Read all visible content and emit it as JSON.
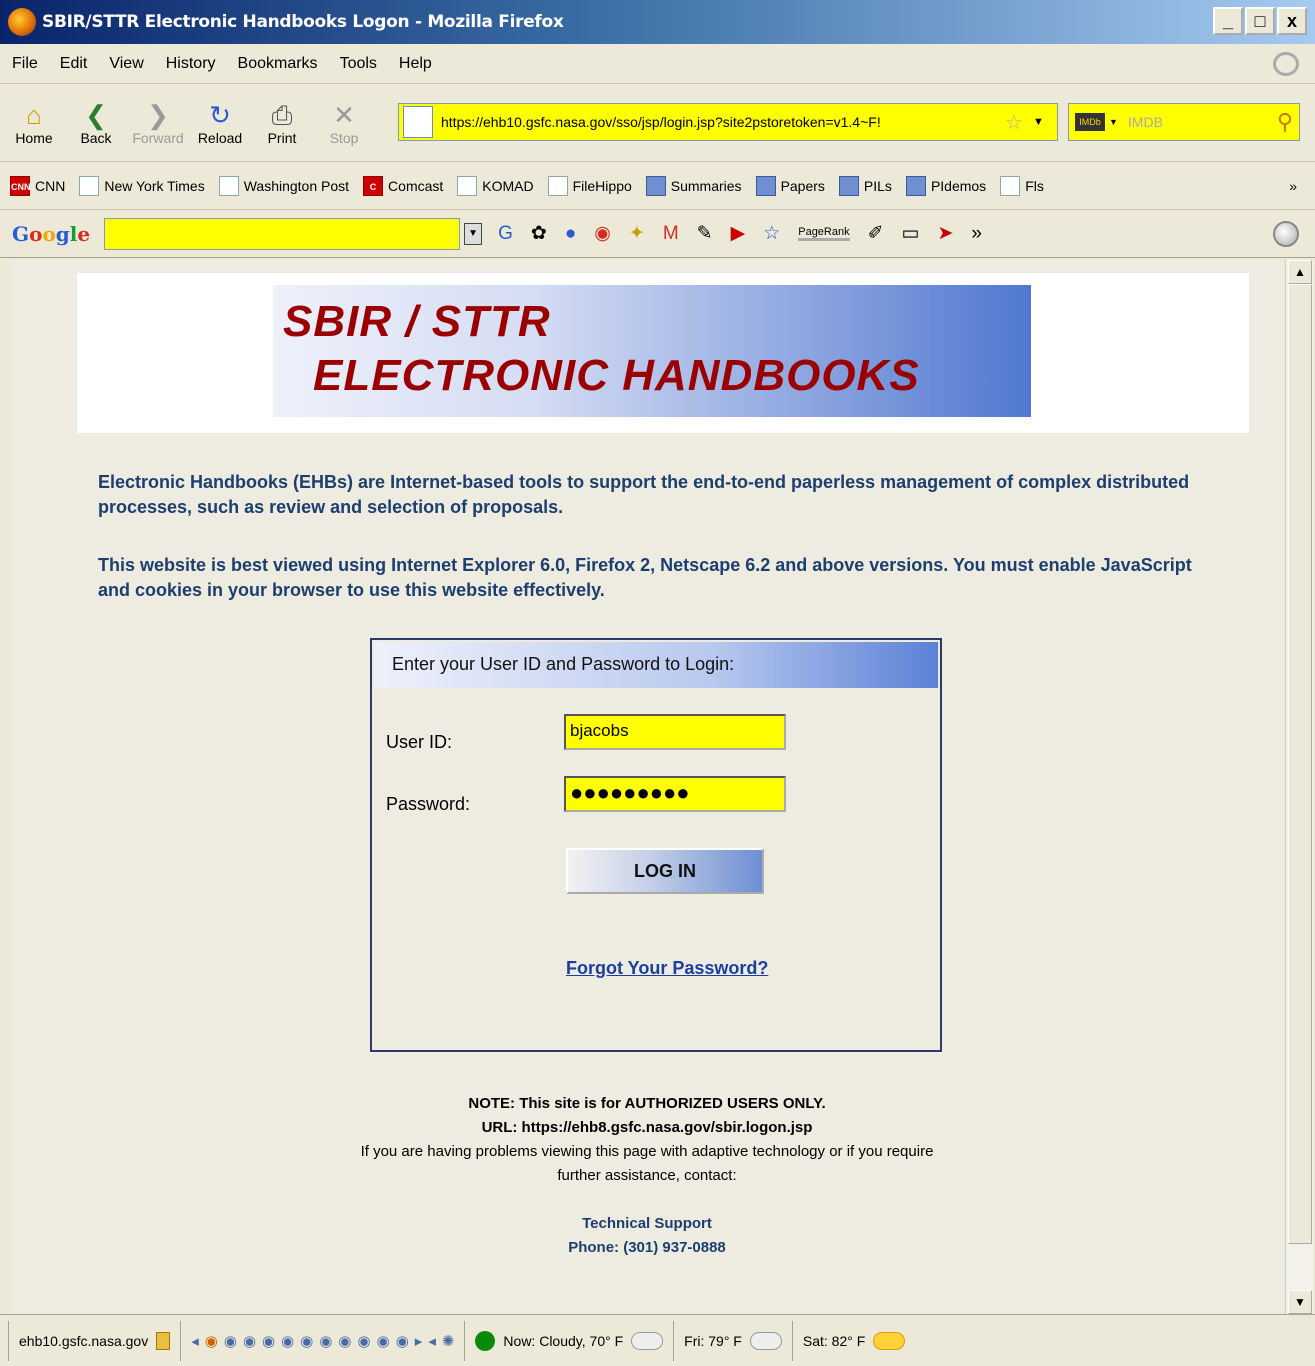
{
  "window": {
    "title": "SBIR/STTR Electronic Handbooks Logon - Mozilla Firefox",
    "min": "_",
    "max": "□",
    "close": "x"
  },
  "menu": [
    "File",
    "Edit",
    "View",
    "History",
    "Bookmarks",
    "Tools",
    "Help"
  ],
  "nav": {
    "buttons": [
      {
        "label": "Home",
        "icon": "home-icon",
        "glyph": "⌂",
        "enabled": true
      },
      {
        "label": "Back",
        "icon": "back-arrow-icon",
        "glyph": "❮",
        "enabled": true
      },
      {
        "label": "Forward",
        "icon": "forward-arrow-icon",
        "glyph": "❯",
        "enabled": false
      },
      {
        "label": "Reload",
        "icon": "reload-icon",
        "glyph": "↻",
        "enabled": true
      },
      {
        "label": "Print",
        "icon": "printer-icon",
        "glyph": "⎙",
        "enabled": true
      },
      {
        "label": "Stop",
        "icon": "stop-icon",
        "glyph": "✕",
        "enabled": false
      }
    ],
    "url": "https://ehb10.gsfc.nasa.gov/sso/jsp/login.jsp?site2pstoretoken=v1.4~F!",
    "search_placeholder": "IMDB"
  },
  "bookmarks": [
    {
      "label": "CNN",
      "style": "red",
      "badge": "CNN"
    },
    {
      "label": "New York Times",
      "style": "plain",
      "badge": ""
    },
    {
      "label": "Washington Post",
      "style": "plain",
      "badge": ""
    },
    {
      "label": "Comcast",
      "style": "red",
      "badge": "C"
    },
    {
      "label": "KOMAD",
      "style": "plain",
      "badge": ""
    },
    {
      "label": "FileHippo",
      "style": "plain",
      "badge": ""
    },
    {
      "label": "Summaries",
      "style": "blue",
      "badge": ""
    },
    {
      "label": "Papers",
      "style": "blue",
      "badge": ""
    },
    {
      "label": "PILs",
      "style": "blue",
      "badge": ""
    },
    {
      "label": "PIdemos",
      "style": "blue",
      "badge": ""
    },
    {
      "label": "Fls",
      "style": "plain",
      "badge": ""
    }
  ],
  "bookmarks_more": "»",
  "google_toolbar": {
    "pagerank_label": "PageRank",
    "overflow": "»"
  },
  "banner": {
    "line1": "SBIR / STTR",
    "line2": "ELECTRONIC HANDBOOKS"
  },
  "intro": {
    "p1": "Electronic Handbooks (EHBs) are Internet-based tools to support the end-to-end paperless management of complex distributed processes, such as review and selection of proposals.",
    "p2": "This website is best viewed using Internet Explorer 6.0, Firefox 2, Netscape 6.2 and above versions. You must enable JavaScript and cookies in your browser to use this website effectively."
  },
  "login": {
    "header": "Enter your User ID and Password to Login:",
    "userid_label": "User ID:",
    "userid_value": "bjacobs",
    "password_label": "Password:",
    "password_value": "●●●●●●●●●",
    "button": "LOG IN",
    "forgot": "Forgot Your Password?"
  },
  "footer": {
    "note": "NOTE: This site is for AUTHORIZED USERS ONLY.",
    "url": "URL: https://ehb8.gsfc.nasa.gov/sbir.logon.jsp",
    "help1": "If you are having problems viewing this page with adaptive technology or if you require",
    "help2": "further assistance, contact:",
    "support_title": "Technical Support",
    "support_phone": "Phone: (301) 937-0888"
  },
  "status": {
    "host": "ehb10.gsfc.nasa.gov",
    "weather_now": "Now: Cloudy, 70° F",
    "weather_fri": "Fri: 79° F",
    "weather_sat": "Sat: 82° F"
  }
}
